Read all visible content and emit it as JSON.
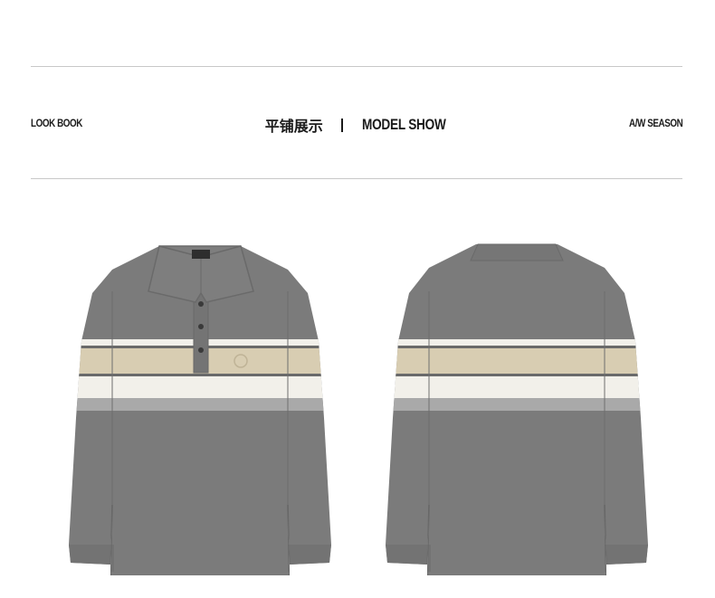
{
  "header": {
    "left_label": "LOOK BOOK",
    "title_cn": "平铺展示",
    "title_en": "MODEL SHOW",
    "right_label": "A/W SEASON"
  },
  "colors": {
    "shirt_gray": "#7b7b7b",
    "shirt_dark": "#6d6d6d",
    "stripe_beige": "#d8cdb2",
    "stripe_cream": "#f2f0ea",
    "stripe_light_gray": "#a9a9a9",
    "rule_gray": "#c8c8c8"
  },
  "products": [
    {
      "view": "front",
      "icon": "polo-shirt-front-icon"
    },
    {
      "view": "back",
      "icon": "polo-shirt-back-icon"
    }
  ]
}
